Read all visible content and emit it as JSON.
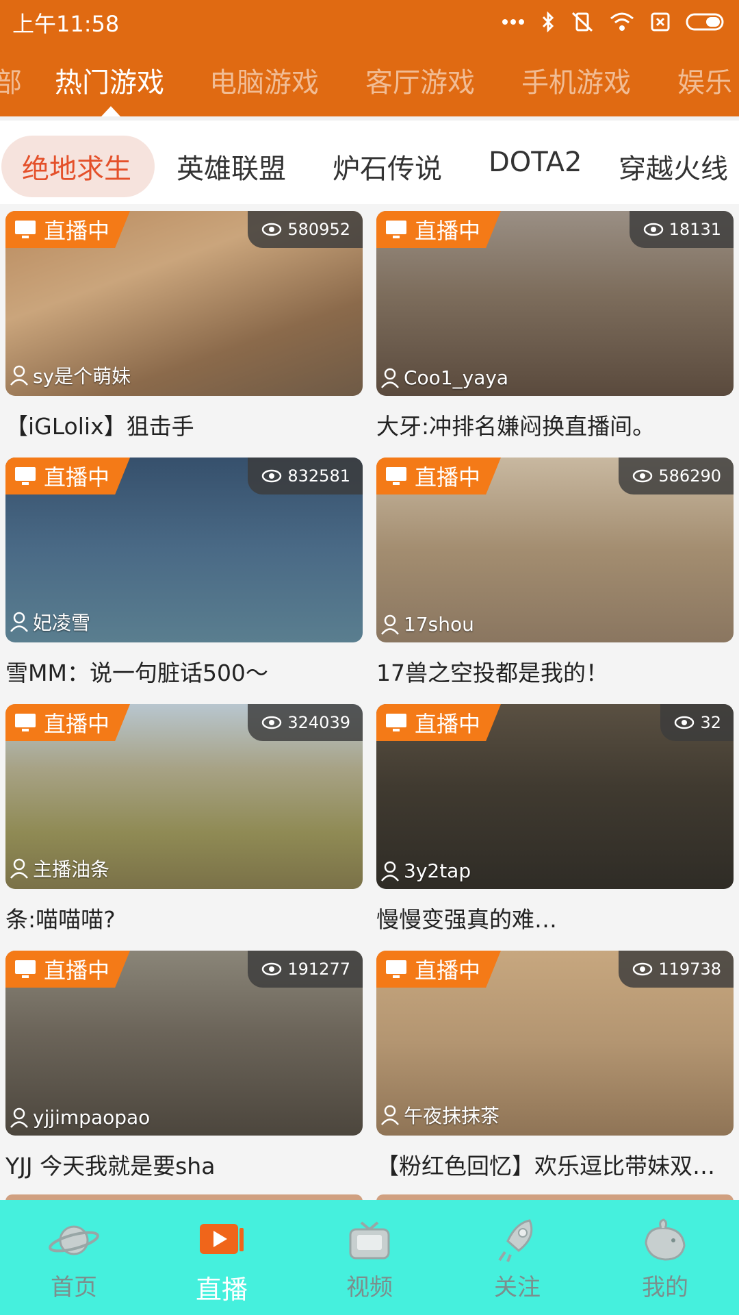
{
  "status_bar": {
    "time": "上午11:58"
  },
  "category_tabs": [
    {
      "label": "部"
    },
    {
      "label": "热门游戏",
      "active": true
    },
    {
      "label": "电脑游戏"
    },
    {
      "label": "客厅游戏"
    },
    {
      "label": "手机游戏"
    },
    {
      "label": "娱乐"
    }
  ],
  "game_tabs": [
    {
      "label": "绝地求生",
      "active": true
    },
    {
      "label": "英雄联盟"
    },
    {
      "label": "炉石传说"
    },
    {
      "label": "DOTA2"
    },
    {
      "label": "穿越火线"
    }
  ],
  "live_label": "直播中",
  "streams": [
    {
      "viewers": "580952",
      "anchor": "sy是个萌妹",
      "title": "【iGLolix】狙击手"
    },
    {
      "viewers": "18131",
      "anchor": "Coo1_yaya",
      "title": "大牙:冲排名嫌闷换直播间。"
    },
    {
      "viewers": "832581",
      "anchor": "妃凌雪",
      "title": "雪MM：说一句脏话500～"
    },
    {
      "viewers": "586290",
      "anchor": "17shou",
      "title": "17兽之空投都是我的！"
    },
    {
      "viewers": "324039",
      "anchor": "主播油条",
      "title": "条:喵喵喵?"
    },
    {
      "viewers": "32",
      "anchor": "3y2tap",
      "title": "慢慢变强真的难…"
    },
    {
      "viewers": "191277",
      "anchor": "yjjimpaopao",
      "title": "YJJ  今天我就是要sha"
    },
    {
      "viewers": "119738",
      "anchor": "午夜抹抹茶",
      "title": "【粉红色回忆】欢乐逗比带妹双…"
    }
  ],
  "bottom_nav": [
    {
      "label": "首页",
      "icon": "planet-icon"
    },
    {
      "label": "直播",
      "icon": "play-tv-icon",
      "active": true
    },
    {
      "label": "视频",
      "icon": "tv-icon"
    },
    {
      "label": "关注",
      "icon": "rocket-icon"
    },
    {
      "label": "我的",
      "icon": "whale-icon"
    }
  ],
  "colors": {
    "header": "#e06a12",
    "live_badge": "#f47a17",
    "active_game": "#e4502a",
    "bottom_nav": "#45f0dd"
  }
}
